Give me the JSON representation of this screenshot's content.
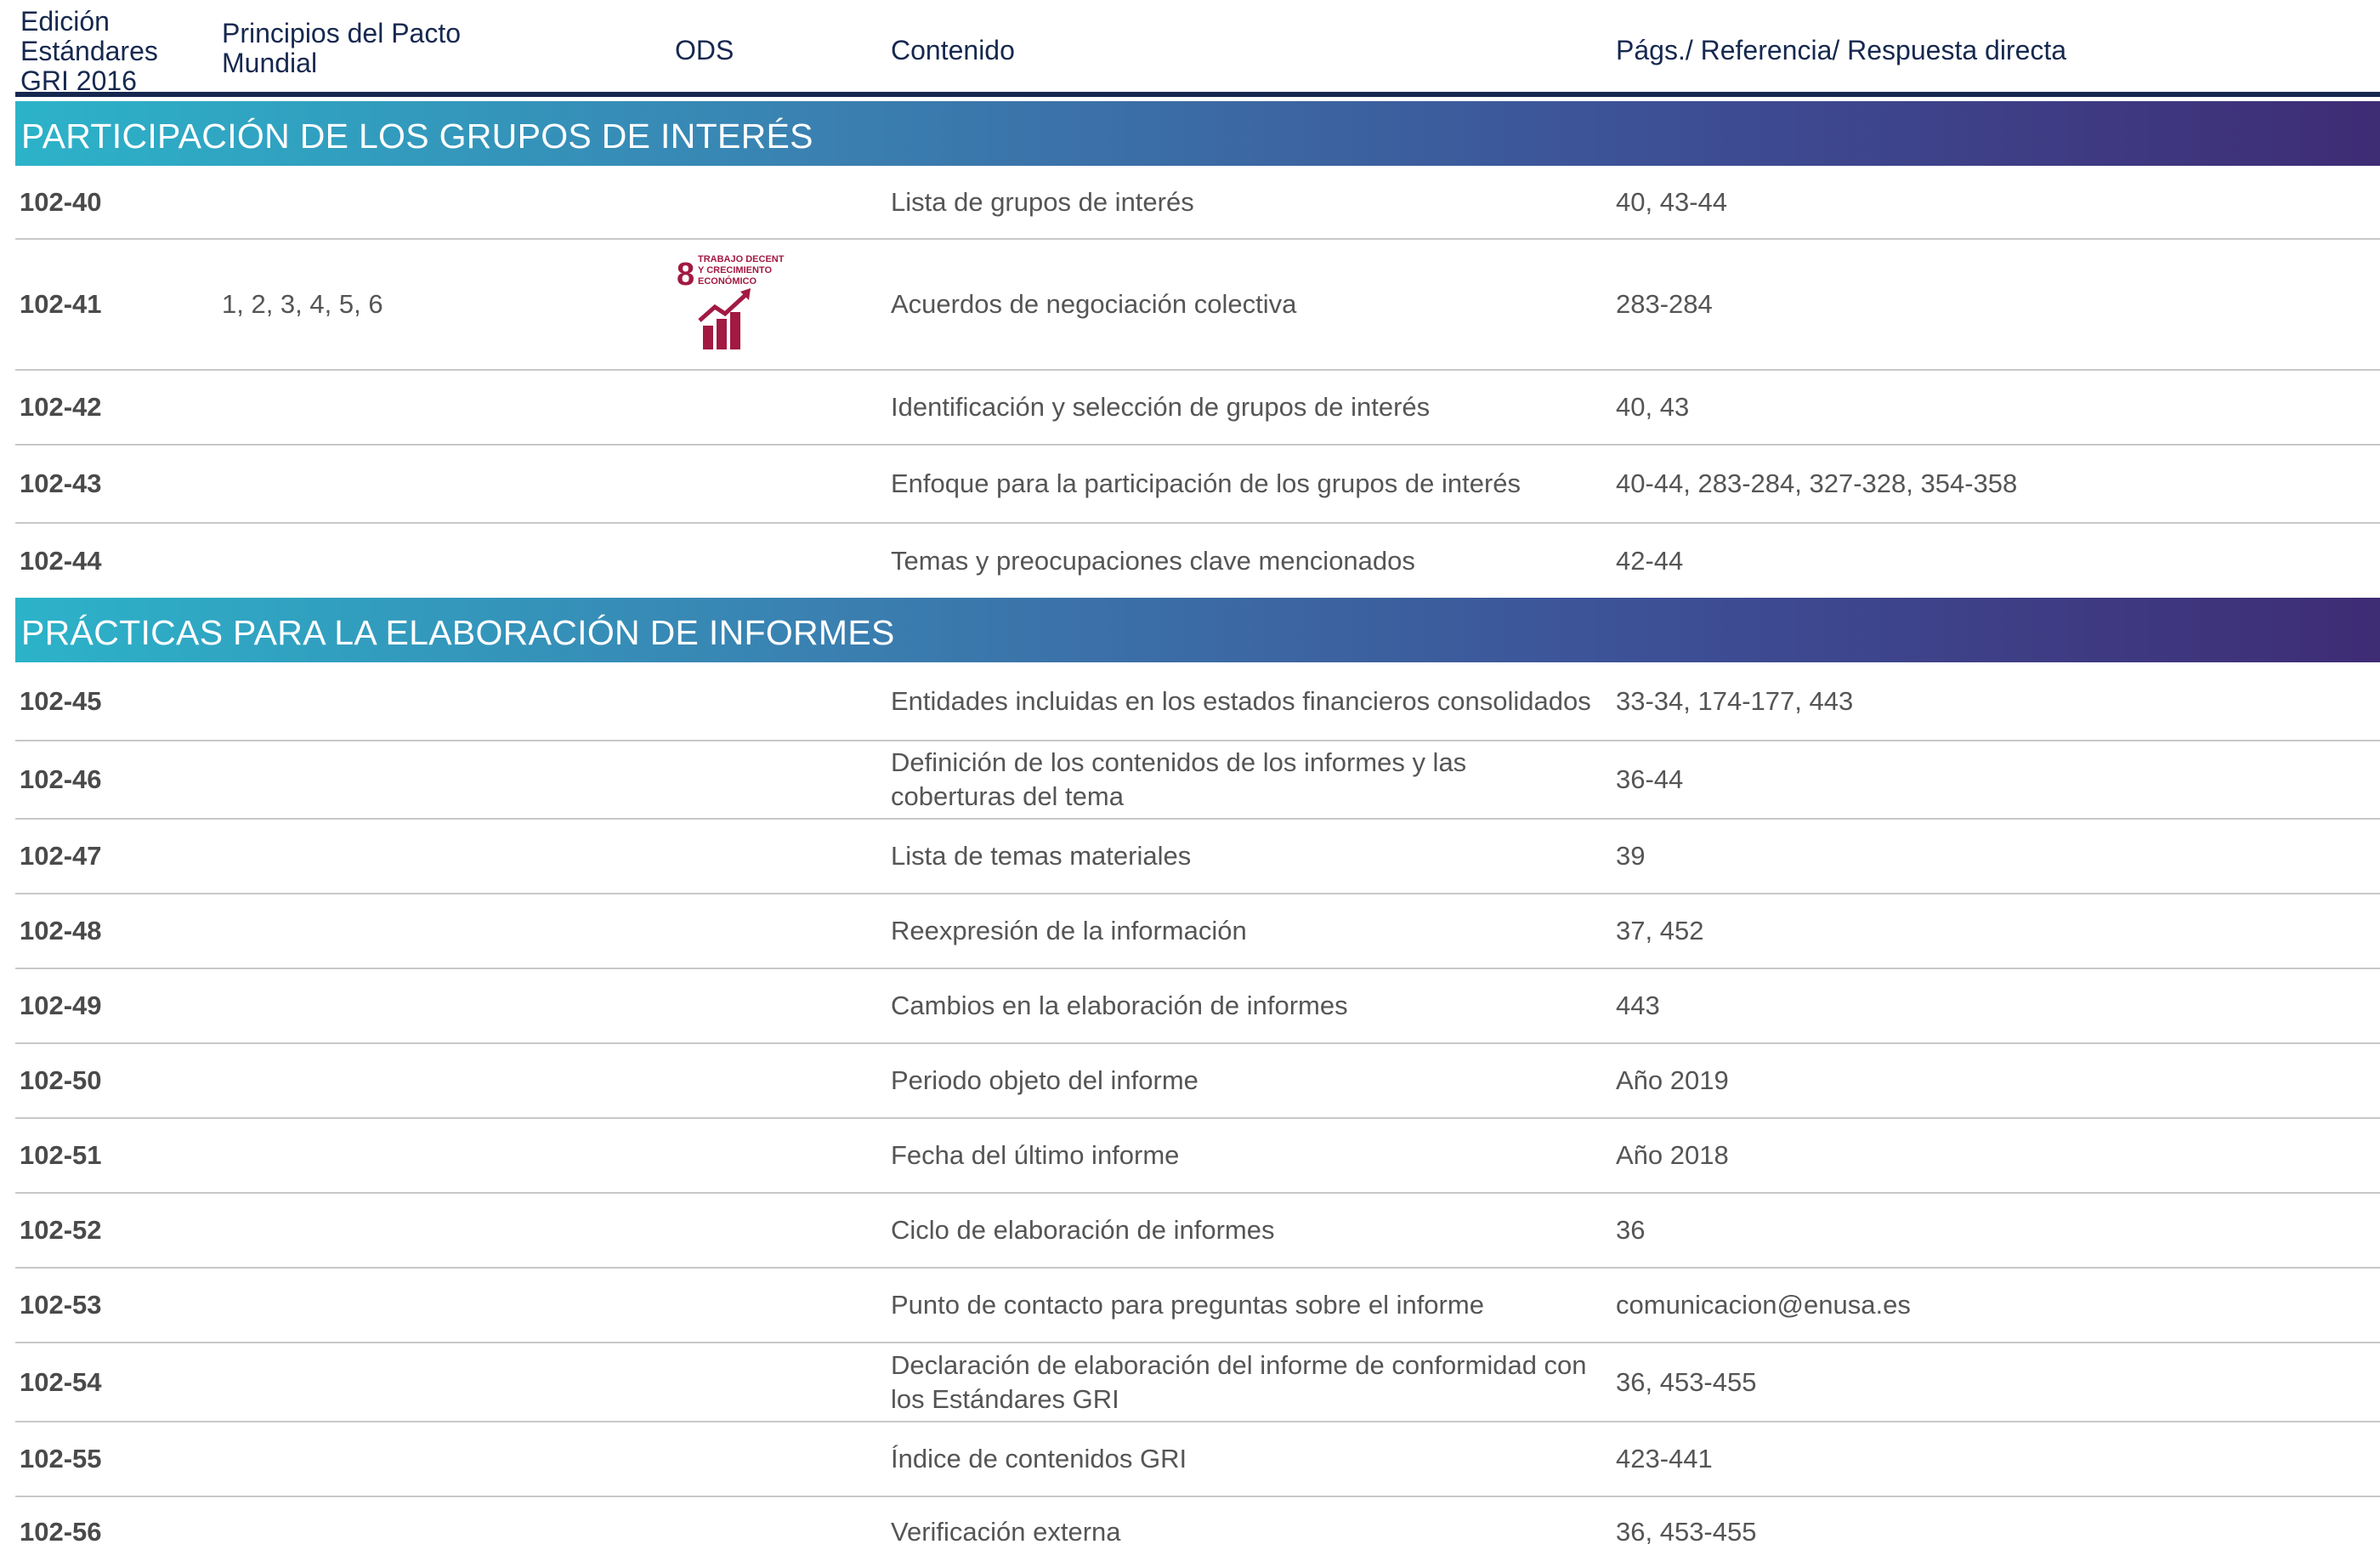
{
  "headers": {
    "gri": "Edición Estándares GRI 2016",
    "pacto": "Principios del Pacto Mundial",
    "ods": "ODS",
    "contenido": "Contenido",
    "pags": "Págs./ Referencia/ Respuesta directa"
  },
  "sections": [
    {
      "title": "PARTICIPACIÓN DE LOS GRUPOS DE INTERÉS",
      "rows": [
        {
          "code": "102-40",
          "pacto": "",
          "ods": "",
          "contenido": "Lista de grupos de interés",
          "pags": "40, 43-44"
        },
        {
          "code": "102-41",
          "pacto": "1, 2, 3, 4, 5, 6",
          "ods": "sdg-8-icon",
          "contenido": "Acuerdos de negociación colectiva",
          "pags": "283-284"
        },
        {
          "code": "102-42",
          "pacto": "",
          "ods": "",
          "contenido": "Identificación y selección de grupos de interés",
          "pags": "40, 43"
        },
        {
          "code": "102-43",
          "pacto": "",
          "ods": "",
          "contenido": "Enfoque para la participación de los grupos de interés",
          "pags": "40-44, 283-284, 327-328, 354-358"
        },
        {
          "code": "102-44",
          "pacto": "",
          "ods": "",
          "contenido": "Temas y preocupaciones clave mencionados",
          "pags": "42-44"
        }
      ]
    },
    {
      "title": "PRÁCTICAS PARA LA ELABORACIÓN DE INFORMES",
      "rows": [
        {
          "code": "102-45",
          "pacto": "",
          "ods": "",
          "contenido": "Entidades incluidas en los estados financieros consolidados",
          "pags": "33-34, 174-177, 443"
        },
        {
          "code": "102-46",
          "pacto": "",
          "ods": "",
          "contenido": "Definición de los contenidos de los informes y las coberturas del tema",
          "pags": "36-44"
        },
        {
          "code": "102-47",
          "pacto": "",
          "ods": "",
          "contenido": "Lista de temas materiales",
          "pags": "39"
        },
        {
          "code": "102-48",
          "pacto": "",
          "ods": "",
          "contenido": "Reexpresión de la información",
          "pags": "37, 452"
        },
        {
          "code": "102-49",
          "pacto": "",
          "ods": "",
          "contenido": "Cambios en la elaboración de informes",
          "pags": "443"
        },
        {
          "code": "102-50",
          "pacto": "",
          "ods": "",
          "contenido": "Periodo objeto del informe",
          "pags": "Año 2019"
        },
        {
          "code": "102-51",
          "pacto": "",
          "ods": "",
          "contenido": "Fecha del último informe",
          "pags": "Año 2018"
        },
        {
          "code": "102-52",
          "pacto": "",
          "ods": "",
          "contenido": "Ciclo de elaboración de informes",
          "pags": "36"
        },
        {
          "code": "102-53",
          "pacto": "",
          "ods": "",
          "contenido": "Punto de contacto para preguntas sobre el informe",
          "pags": "comunicacion@enusa.es"
        },
        {
          "code": "102-54",
          "pacto": "",
          "ods": "",
          "contenido": "Declaración de elaboración del informe de conformidad con los Estándares GRI",
          "pags": "36, 453-455"
        },
        {
          "code": "102-55",
          "pacto": "",
          "ods": "",
          "contenido": "Índice de contenidos GRI",
          "pags": "423-441"
        },
        {
          "code": "102-56",
          "pacto": "",
          "ods": "",
          "contenido": "Verificación externa",
          "pags": "36, 453-455"
        }
      ]
    }
  ],
  "sdg8": {
    "number": "8",
    "label_line1": "TRABAJO DECENTE",
    "label_line2": "Y CRECIMIENTO",
    "label_line3": "ECONÓMICO",
    "color": "#a21942"
  },
  "colors": {
    "header_text": "#16284f",
    "header_rule": "#16284f",
    "bar_start": "#2cb3c9",
    "bar_end": "#3e2c75",
    "row_rule": "#c8c8c8"
  }
}
